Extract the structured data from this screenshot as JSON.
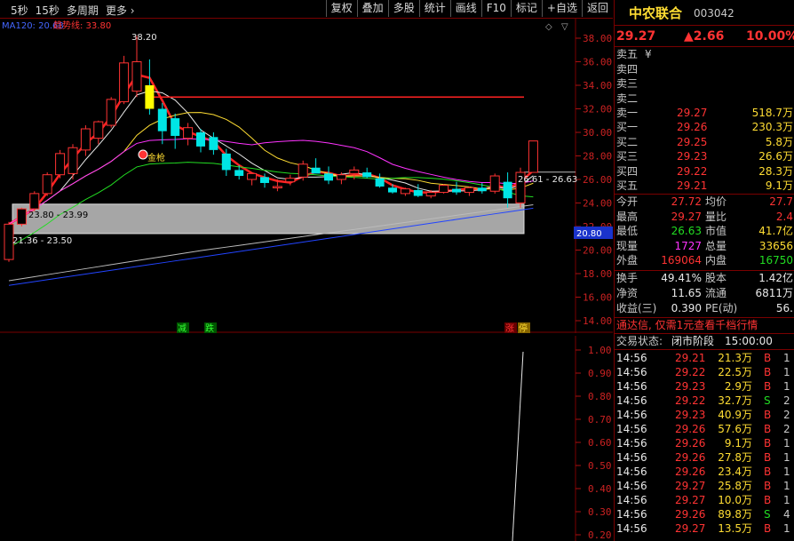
{
  "toolbar": {
    "periods": [
      "5秒",
      "15秒",
      "多周期",
      "更多 ›"
    ],
    "buttons": [
      "复权",
      "叠加",
      "多股",
      "统计",
      "画线",
      "F10",
      "标记",
      "+自选",
      "返回"
    ]
  },
  "main_chart": {
    "legend": {
      "ma": "MA120: 20.68",
      "trend": "趋势线: 33.80"
    },
    "price_axis": [
      "38.00",
      "36.00",
      "34.00",
      "32.00",
      "30.00",
      "28.00",
      "26.00",
      "24.00",
      "22.00",
      "20.00",
      "18.00",
      "16.00",
      "14.00"
    ],
    "annotations": {
      "high": "38.20",
      "band": "23.80 - 23.99",
      "band_low": "21.36 - 23.50",
      "right_range": "26.61 - 26.63",
      "right_price": "20.80",
      "signal": "金枪",
      "sig1": "减",
      "sig2": "跌",
      "sig3a": "涨",
      "sig3b": "停"
    }
  },
  "sub_chart": {
    "axis": [
      "1.00",
      "0.90",
      "0.80",
      "0.70",
      "0.60",
      "0.50",
      "0.40",
      "0.30",
      "0.20"
    ]
  },
  "chart_data": {
    "type": "candlestick",
    "price_range": [
      14,
      38
    ],
    "candles": [
      {
        "o": 19.2,
        "h": 22.4,
        "l": 19.0,
        "c": 22.2
      },
      {
        "o": 22.2,
        "h": 23.6,
        "l": 22.0,
        "c": 23.5
      },
      {
        "o": 23.5,
        "h": 25.0,
        "l": 23.3,
        "c": 24.8
      },
      {
        "o": 24.8,
        "h": 26.6,
        "l": 24.6,
        "c": 26.4
      },
      {
        "o": 26.4,
        "h": 28.5,
        "l": 26.1,
        "c": 28.2
      },
      {
        "o": 26.5,
        "h": 29.0,
        "l": 26.0,
        "c": 28.7
      },
      {
        "o": 28.5,
        "h": 30.6,
        "l": 28.0,
        "c": 30.3
      },
      {
        "o": 29.5,
        "h": 31.0,
        "l": 29.0,
        "c": 30.9
      },
      {
        "o": 30.6,
        "h": 33.0,
        "l": 30.4,
        "c": 32.8
      },
      {
        "o": 32.6,
        "h": 36.5,
        "l": 32.4,
        "c": 35.9
      },
      {
        "o": 33.5,
        "h": 38.2,
        "l": 33.0,
        "c": 36.0
      },
      {
        "o": 34.0,
        "h": 36.2,
        "l": 31.5,
        "c": 32.0
      },
      {
        "o": 32.0,
        "h": 32.5,
        "l": 29.0,
        "c": 30.1
      },
      {
        "o": 31.2,
        "h": 31.6,
        "l": 28.6,
        "c": 29.7
      },
      {
        "o": 29.5,
        "h": 30.8,
        "l": 28.9,
        "c": 30.4
      },
      {
        "o": 30.0,
        "h": 30.3,
        "l": 28.3,
        "c": 28.8
      },
      {
        "o": 29.6,
        "h": 30.0,
        "l": 28.1,
        "c": 28.5
      },
      {
        "o": 28.2,
        "h": 28.6,
        "l": 26.3,
        "c": 26.8
      },
      {
        "o": 26.8,
        "h": 27.2,
        "l": 26.0,
        "c": 26.3
      },
      {
        "o": 26.0,
        "h": 26.6,
        "l": 25.5,
        "c": 26.5
      },
      {
        "o": 26.2,
        "h": 26.5,
        "l": 25.3,
        "c": 25.7
      },
      {
        "o": 25.4,
        "h": 26.0,
        "l": 25.0,
        "c": 25.4
      },
      {
        "o": 25.8,
        "h": 26.4,
        "l": 25.5,
        "c": 26.1
      },
      {
        "o": 26.2,
        "h": 27.6,
        "l": 25.9,
        "c": 27.3
      },
      {
        "o": 27.0,
        "h": 27.8,
        "l": 26.6,
        "c": 26.5
      },
      {
        "o": 26.5,
        "h": 27.1,
        "l": 25.6,
        "c": 25.9
      },
      {
        "o": 26.0,
        "h": 26.6,
        "l": 25.6,
        "c": 26.4
      },
      {
        "o": 26.5,
        "h": 27.1,
        "l": 26.0,
        "c": 26.8
      },
      {
        "o": 26.6,
        "h": 27.0,
        "l": 26.1,
        "c": 26.2
      },
      {
        "o": 26.1,
        "h": 26.5,
        "l": 25.3,
        "c": 25.4
      },
      {
        "o": 25.3,
        "h": 25.6,
        "l": 24.8,
        "c": 24.9
      },
      {
        "o": 24.8,
        "h": 25.3,
        "l": 24.6,
        "c": 25.2
      },
      {
        "o": 25.1,
        "h": 25.6,
        "l": 24.5,
        "c": 24.6
      },
      {
        "o": 24.6,
        "h": 25.1,
        "l": 24.4,
        "c": 24.9
      },
      {
        "o": 24.9,
        "h": 25.6,
        "l": 24.8,
        "c": 25.5
      },
      {
        "o": 25.2,
        "h": 25.8,
        "l": 24.7,
        "c": 24.9
      },
      {
        "o": 24.9,
        "h": 25.4,
        "l": 24.6,
        "c": 25.3
      },
      {
        "o": 25.3,
        "h": 25.7,
        "l": 24.8,
        "c": 25.0
      },
      {
        "o": 25.0,
        "h": 26.5,
        "l": 24.8,
        "c": 26.3
      },
      {
        "o": 25.8,
        "h": 26.6,
        "l": 23.6,
        "c": 24.4
      },
      {
        "o": 24.0,
        "h": 27.0,
        "l": 23.6,
        "c": 26.6
      },
      {
        "o": 26.6,
        "h": 29.27,
        "l": 26.6,
        "c": 29.27
      }
    ],
    "trend_line": 33.0,
    "band": [
      23.9,
      21.4
    ]
  },
  "stock": {
    "name": "中农联合",
    "code": "003042",
    "price": "29.27",
    "change": "▲2.66",
    "pct": "10.00%"
  },
  "orderbook": {
    "asks": [
      {
        "label": "卖五",
        "suffix": "¥",
        "price": "",
        "vol": ""
      },
      {
        "label": "卖四",
        "suffix": "",
        "price": "",
        "vol": ""
      },
      {
        "label": "卖三",
        "suffix": "",
        "price": "",
        "vol": ""
      },
      {
        "label": "卖二",
        "suffix": "",
        "price": "",
        "vol": ""
      },
      {
        "label": "卖一",
        "suffix": "",
        "price": "29.27",
        "vol": "518.7万"
      }
    ],
    "bids": [
      {
        "label": "买一",
        "price": "29.26",
        "vol": "230.3万"
      },
      {
        "label": "买二",
        "price": "29.25",
        "vol": "5.8万"
      },
      {
        "label": "买三",
        "price": "29.23",
        "vol": "26.6万"
      },
      {
        "label": "买四",
        "price": "29.22",
        "vol": "28.3万"
      },
      {
        "label": "买五",
        "price": "29.21",
        "vol": "9.1万"
      }
    ]
  },
  "quote": [
    {
      "l1": "今开",
      "v1": "27.72",
      "l2": "均价",
      "v2": "27.7"
    },
    {
      "l1": "最高",
      "v1": "29.27",
      "l2": "量比",
      "v2": "2.4"
    },
    {
      "l1": "最低",
      "v1": "26.63",
      "l2": "市值",
      "v2": "41.7亿"
    },
    {
      "l1": "现量",
      "v1": "1727",
      "l2": "总量",
      "v2": "33656"
    },
    {
      "l1": "外盘",
      "v1": "169064",
      "l2": "内盘",
      "v2": "16750"
    }
  ],
  "stats": [
    {
      "l1": "换手",
      "v1": "49.41%",
      "l2": "股本",
      "v2": "1.42亿"
    },
    {
      "l1": "净资",
      "v1": "11.65",
      "l2": "流通",
      "v2": "6811万"
    },
    {
      "l1": "收益(三)",
      "v1": "0.390",
      "l2": "PE(动)",
      "v2": "56."
    }
  ],
  "notice": "通达信, 仅需1元查看千档行情",
  "trade_status": {
    "label": "交易状态:",
    "status": "闭市阶段",
    "time": "15:00:00"
  },
  "ticks": [
    {
      "t": "14:56",
      "p": "29.21",
      "v": "21.3万",
      "s": "B",
      "n": "1"
    },
    {
      "t": "14:56",
      "p": "29.22",
      "v": "22.5万",
      "s": "B",
      "n": "1"
    },
    {
      "t": "14:56",
      "p": "29.23",
      "v": "2.9万",
      "s": "B",
      "n": "1"
    },
    {
      "t": "14:56",
      "p": "29.22",
      "v": "32.7万",
      "s": "S",
      "n": "2"
    },
    {
      "t": "14:56",
      "p": "29.23",
      "v": "40.9万",
      "s": "B",
      "n": "2"
    },
    {
      "t": "14:56",
      "p": "29.26",
      "v": "57.6万",
      "s": "B",
      "n": "2"
    },
    {
      "t": "14:56",
      "p": "29.26",
      "v": "9.1万",
      "s": "B",
      "n": "1"
    },
    {
      "t": "14:56",
      "p": "29.26",
      "v": "27.8万",
      "s": "B",
      "n": "1"
    },
    {
      "t": "14:56",
      "p": "29.26",
      "v": "23.4万",
      "s": "B",
      "n": "1"
    },
    {
      "t": "14:56",
      "p": "29.27",
      "v": "25.8万",
      "s": "B",
      "n": "1"
    },
    {
      "t": "14:56",
      "p": "29.27",
      "v": "10.0万",
      "s": "B",
      "n": "1"
    },
    {
      "t": "14:56",
      "p": "29.26",
      "v": "89.8万",
      "s": "S",
      "n": "4"
    },
    {
      "t": "14:56",
      "p": "29.27",
      "v": "13.5万",
      "s": "B",
      "n": "1"
    }
  ]
}
